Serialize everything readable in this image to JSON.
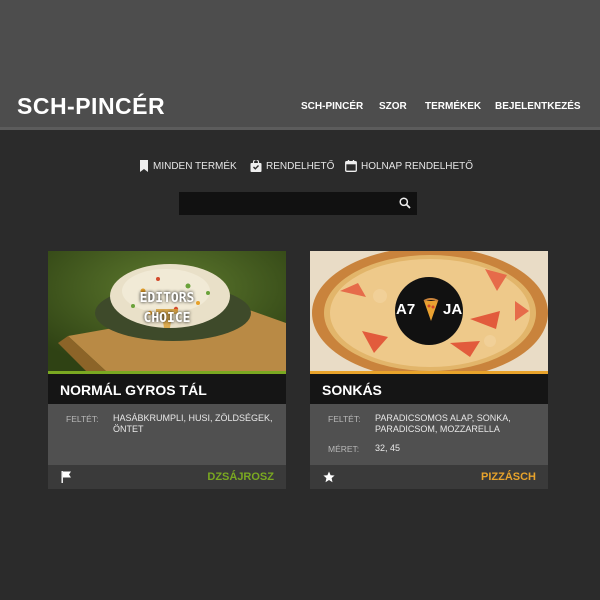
{
  "header": {
    "brand": "SCH-PINCÉR",
    "nav": [
      {
        "label": "SCH-PINCÉR",
        "name": "nav-sch-pincer"
      },
      {
        "label": "SZOR",
        "name": "nav-szor"
      },
      {
        "label": "TERMÉKEK",
        "name": "nav-termekek"
      },
      {
        "label": "BEJELENTKEZÉS",
        "name": "nav-bejelentkezes"
      }
    ]
  },
  "filters": [
    {
      "label": "MINDEN TERMÉK",
      "icon": "bookmark-icon"
    },
    {
      "label": "RENDELHETŐ",
      "icon": "shopping-bag-icon"
    },
    {
      "label": "HOLNAP RENDELHETŐ",
      "icon": "calendar-icon"
    }
  ],
  "search": {
    "value": "",
    "placeholder": "",
    "icon": "search-icon"
  },
  "cards": [
    {
      "title": "NORMÁL GYROS TÁL",
      "badge": "EDITORS CHOICE",
      "badge_line1": "EDITORS",
      "badge_line2": "CHOICE",
      "accent": "#7aa821",
      "details": [
        {
          "label": "FELTÉT:",
          "value": "HASÁBKRUMPLI, HUSI, ZÖLDSÉGEK, ÖNTET"
        }
      ],
      "footer_icon": "flag-icon",
      "category": "DZSÁJROSZ"
    },
    {
      "title": "SONKÁS",
      "logo_text": "A7 JA",
      "logo_left": "A7",
      "logo_right": "JA",
      "accent": "#e8a32b",
      "details": [
        {
          "label": "FELTÉT:",
          "value": "PARADICSOMOS ALAP, SONKA, PARADICSOM, MOZZARELLA"
        },
        {
          "label": "MÉRET:",
          "value": "32, 45"
        }
      ],
      "footer_icon": "star-icon",
      "category": "PIZZÁSCH"
    }
  ]
}
